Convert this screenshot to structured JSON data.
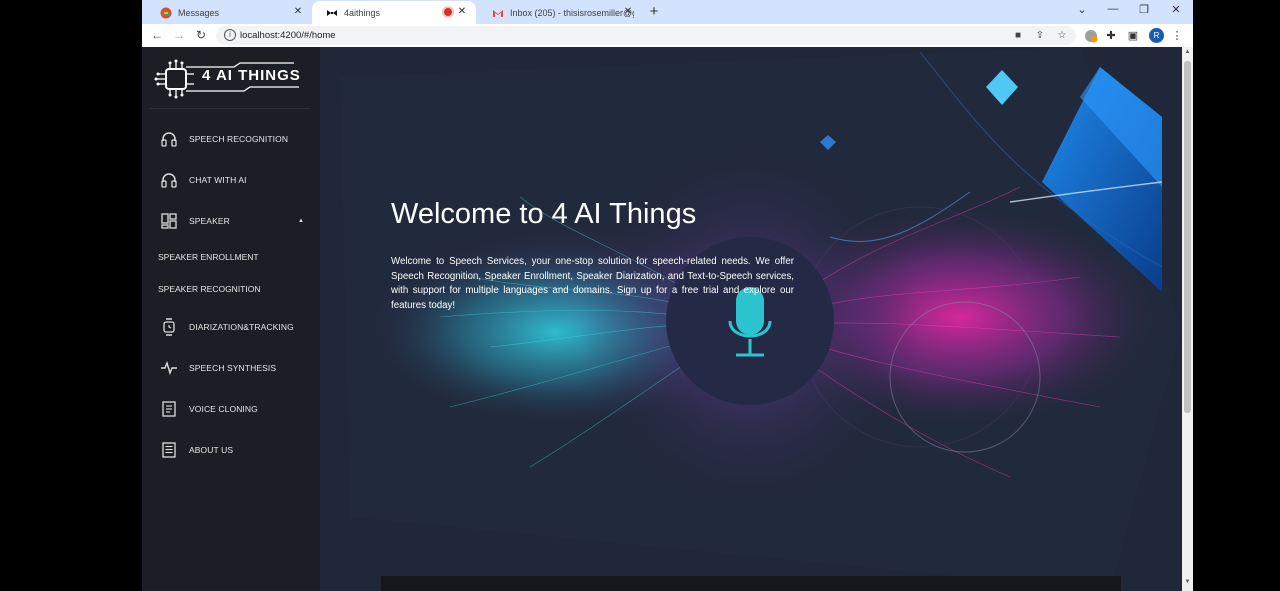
{
  "browser": {
    "tabs": [
      {
        "title": "Messages",
        "favicon": "messages-icon"
      },
      {
        "title": "4aithings",
        "favicon": "bowtie-icon",
        "recording": true
      },
      {
        "title": "Inbox (205) - thisisrosemiller@g",
        "favicon": "gmail-icon"
      }
    ],
    "new_tab_label": "+",
    "url": "localhost:4200/#/home",
    "profile_initial": "R",
    "extension_badge": "2"
  },
  "sidebar": {
    "logo_text": "4 AI THINGS",
    "items": [
      {
        "label": "SPEECH RECOGNITION",
        "icon": "headphones-icon"
      },
      {
        "label": "CHAT WITH AI",
        "icon": "headphones-icon"
      },
      {
        "label": "SPEAKER",
        "icon": "dashboard-icon",
        "expanded": true
      },
      {
        "label": "SPEAKER ENROLLMENT"
      },
      {
        "label": "SPEAKER RECOGNITION"
      },
      {
        "label": "DIARIZATION&TRACKING",
        "icon": "watch-icon"
      },
      {
        "label": "SPEECH SYNTHESIS",
        "icon": "waveform-icon"
      },
      {
        "label": "VOICE CLONING",
        "icon": "document-icon"
      },
      {
        "label": "ABOUT US",
        "icon": "list-document-icon"
      }
    ]
  },
  "hero": {
    "title": "Welcome to 4 AI Things",
    "description": "Welcome to Speech Services, your one-stop solution for speech-related needs. We offer Speech Recognition, Speaker Enrollment, Speaker Diarization, and Text-to-Speech services, with support for multiple languages and domains. Sign up for a free trial and explore our features today!",
    "mic_icon": "microphone-icon"
  },
  "colors": {
    "sidebar_bg": "#1b1e24",
    "page_bg": "#1f2738",
    "accent_cyan": "#2bc4cf",
    "accent_magenta": "#e0279e",
    "accent_blue": "#1a6fd8"
  }
}
